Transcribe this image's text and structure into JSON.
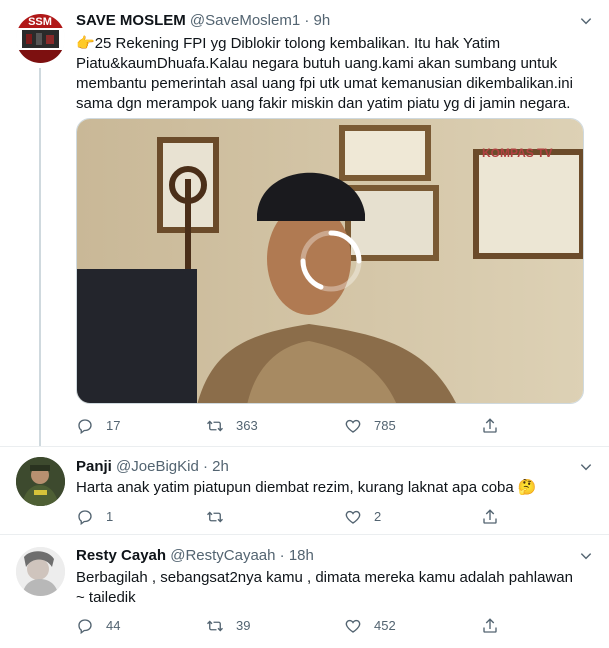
{
  "tweets": [
    {
      "name": "SAVE MOSLEM",
      "handle": "@SaveMoslem1",
      "time": "9h",
      "emoji": "👉",
      "lines": [
        "25 Rekening FPI yg Diblokir tolong kembalikan. Itu hak Yatim",
        "Piatu&kaumDhuafa.Kalau negara butuh uang.kami akan sumbang untuk",
        "membantu pemerintah asal uang fpi utk umat kemanusian dikembalikan.ini",
        "sama dgn merampok uang fakir miskin dan yatim piatu yg di jamin negara."
      ],
      "media": {
        "watermark": "KOMPAS TV",
        "state": "loading"
      },
      "replies": "17",
      "retweets": "363",
      "likes": "785"
    },
    {
      "name": "Panji",
      "handle": "@JoeBigKid",
      "time": "2h",
      "lines": [
        "Harta anak yatim piatupun diembat rezim, kurang laknat apa coba"
      ],
      "emoji": "🤔",
      "replies": "1",
      "retweets": "",
      "likes": "2"
    },
    {
      "name": "Resty Cayah",
      "handle": "@RestyCayaah",
      "time": "18h",
      "lines": [
        "Berbagilah  , sebangsat2nya kamu , dimata mereka kamu adalah pahlawan",
        "~ tailedik"
      ],
      "replies": "44",
      "retweets": "39",
      "likes": "452"
    }
  ],
  "separator": "·",
  "icons": {
    "reply": "reply-icon",
    "retweet": "retweet-icon",
    "like": "heart-icon",
    "share": "share-icon",
    "more": "chevron-down-icon"
  },
  "colors": {
    "text": "#0f1419",
    "secondary": "#536471",
    "border": "#ebeef0"
  }
}
